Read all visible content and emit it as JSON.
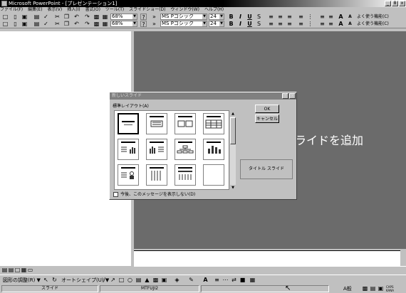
{
  "window": {
    "title": "Microsoft PowerPoint - [プレゼンテーション1]",
    "min": "_",
    "max": "8",
    "close": "x"
  },
  "menu": [
    "ファイル(F)",
    "編集(E)",
    "表示(V)",
    "挿入(I)",
    "書式(O)",
    "ツール(T)",
    "スライドショー(D)",
    "ウィンドウ(W)",
    "ヘルプ(H)"
  ],
  "toolbar1": {
    "zoom": "68%",
    "help": "?",
    "font": "MS Pゴシック",
    "size": "24",
    "bold": "B",
    "italic": "I",
    "underline": "U",
    "shadow": "S",
    "grow": "A",
    "shrink": "A",
    "task": "よく使う機能(C)"
  },
  "toolbar2": {
    "zoom": "68%",
    "help": "?",
    "font": "MS Pゴシック",
    "size": "24",
    "bold": "B",
    "italic": "I",
    "underline": "U",
    "shadow": "S",
    "grow": "A",
    "shrink": "A",
    "task": "よく使う機能(C)"
  },
  "slide": {
    "add_text": "ライドを追加"
  },
  "dialog": {
    "title": "新しいスライド",
    "help": "?",
    "close": "x",
    "layout_label": "標準レイアウト(A)",
    "ok": "OK",
    "cancel": "キャンセル",
    "preview": "タイトル スライド",
    "dont_show": "今後、このメッセージを表示しない(D)"
  },
  "drawbar": {
    "draw": "図形の調整(R)",
    "autoshape": "オートシェイプ(U)"
  },
  "status": {
    "slide": "スライド",
    "template": "MTFUJI2"
  },
  "ime": {
    "mode": "A般",
    "caps": "CAPS",
    "kana": "KANA"
  }
}
